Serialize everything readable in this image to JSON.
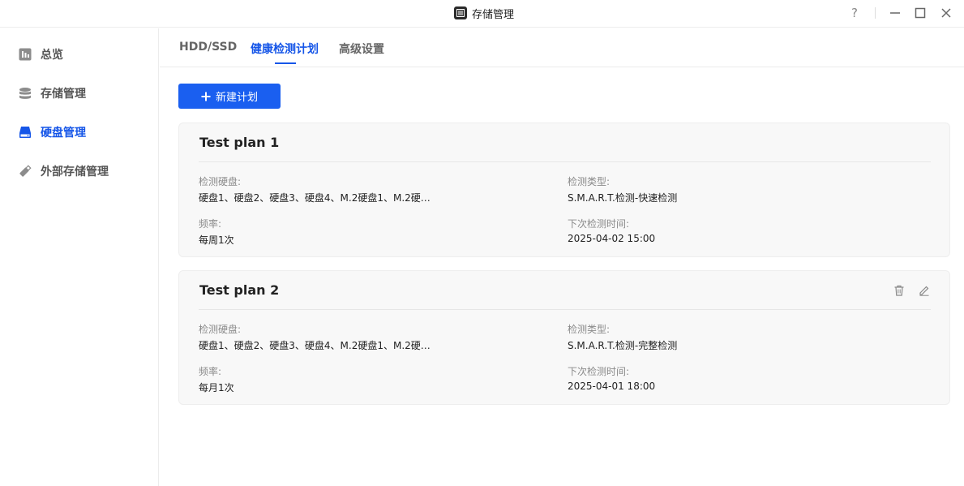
{
  "window": {
    "title": "存储管理",
    "icon": "storage-app-icon",
    "controls": {
      "help": "?"
    }
  },
  "sidebar": {
    "items": [
      {
        "label": "总览",
        "icon": "bar-chart-icon",
        "active": false
      },
      {
        "label": "存储管理",
        "icon": "database-icon",
        "active": false
      },
      {
        "label": "硬盘管理",
        "icon": "disk-icon",
        "active": true
      },
      {
        "label": "外部存储管理",
        "icon": "usb-drive-icon",
        "active": false
      }
    ]
  },
  "tabs": [
    {
      "label": "HDD/SSD",
      "active": false
    },
    {
      "label": "健康检测计划",
      "active": true
    },
    {
      "label": "高级设置",
      "active": false
    }
  ],
  "toolbar": {
    "new_plan_label": "新建计划"
  },
  "plans": [
    {
      "name": "Test plan 1",
      "disks_label": "检测硬盘:",
      "disks_value": "硬盘1、硬盘2、硬盘3、硬盘4、M.2硬盘1、M.2硬…",
      "type_label": "检测类型:",
      "type_value": "S.M.A.R.T.检测-快速检测",
      "freq_label": "频率:",
      "freq_value": "每周1次",
      "next_label": "下次检测时间:",
      "next_value": "2025-04-02 15:00"
    },
    {
      "name": "Test plan 2",
      "disks_label": "检测硬盘:",
      "disks_value": "硬盘1、硬盘2、硬盘3、硬盘4、M.2硬盘1、M.2硬…",
      "type_label": "检测类型:",
      "type_value": "S.M.A.R.T.检测-完整检测",
      "freq_label": "频率:",
      "freq_value": "每月1次",
      "next_label": "下次检测时间:",
      "next_value": "2025-04-01 18:00"
    }
  ],
  "colors": {
    "accent": "#1656e8",
    "button_bg": "#1a5ff0",
    "card_bg": "#f8f8f8"
  }
}
